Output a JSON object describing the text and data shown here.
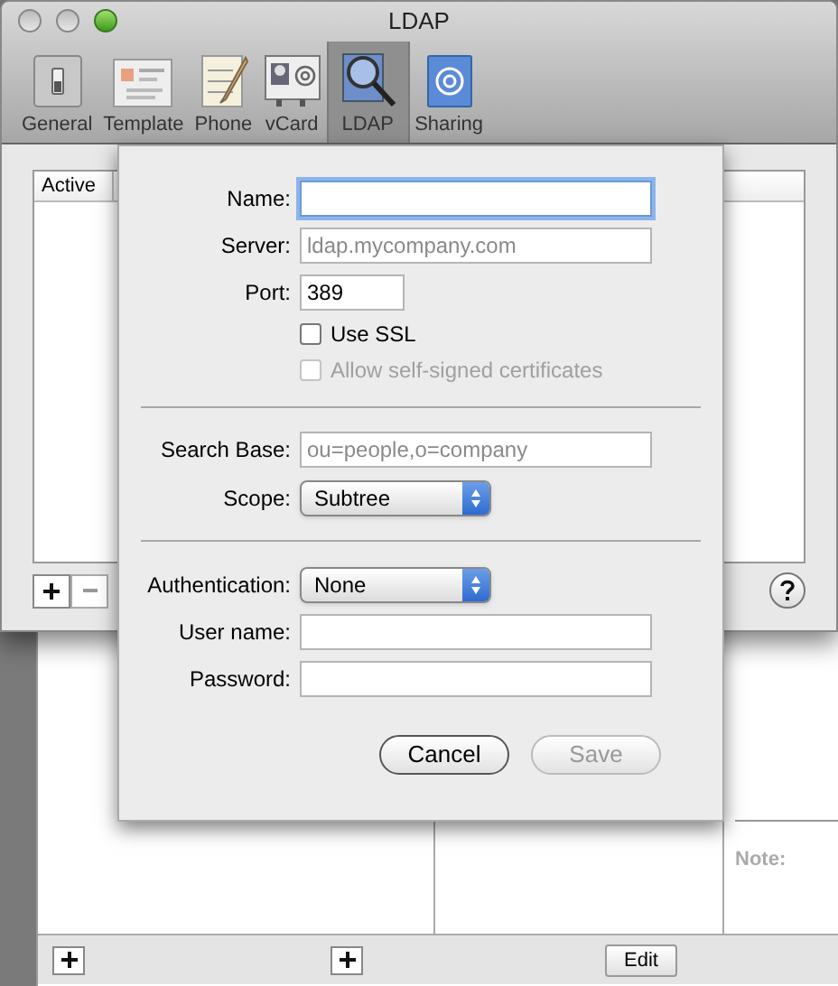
{
  "window": {
    "title": "LDAP"
  },
  "toolbar": [
    {
      "label": "General",
      "kind": "switch",
      "selected": false
    },
    {
      "label": "Template",
      "kind": "card",
      "selected": false
    },
    {
      "label": "Phone",
      "kind": "notepad",
      "selected": false
    },
    {
      "label": "vCard",
      "kind": "vcard",
      "selected": false
    },
    {
      "label": "LDAP",
      "kind": "magnifier",
      "selected": true
    },
    {
      "label": "Sharing",
      "kind": "at",
      "selected": false
    }
  ],
  "table": {
    "columns": [
      "Active"
    ]
  },
  "sheet": {
    "fields": [
      {
        "label": "Name:",
        "kind": "text",
        "focused": true
      },
      {
        "label": "Server:",
        "kind": "text",
        "placeholder": "ldap.mycompany.com",
        "focused": false
      },
      {
        "label": "Port:",
        "kind": "short",
        "value": "389",
        "focused": false
      },
      {
        "label": "Use SSL",
        "kind": "checkbox",
        "checked": false,
        "disabled": false
      },
      {
        "label": "Allow self-signed certificates",
        "kind": "checkbox",
        "checked": false,
        "disabled": true
      },
      {
        "kind": "separator"
      },
      {
        "label": "Search Base:",
        "kind": "text",
        "placeholder": "ou=people,o=company",
        "focused": false
      },
      {
        "label": "Scope:",
        "kind": "popup",
        "value": "Subtree"
      },
      {
        "kind": "separator"
      },
      {
        "label": "Authentication:",
        "kind": "popup",
        "value": "None"
      },
      {
        "label": "User name:",
        "kind": "text",
        "focused": false
      },
      {
        "label": "Password:",
        "kind": "text",
        "focused": false
      }
    ],
    "buttons": [
      {
        "label": "Cancel",
        "disabled": false
      },
      {
        "label": "Save",
        "disabled": true
      }
    ]
  },
  "back_window": {
    "note_label": "Note:",
    "edit_button": "Edit"
  }
}
